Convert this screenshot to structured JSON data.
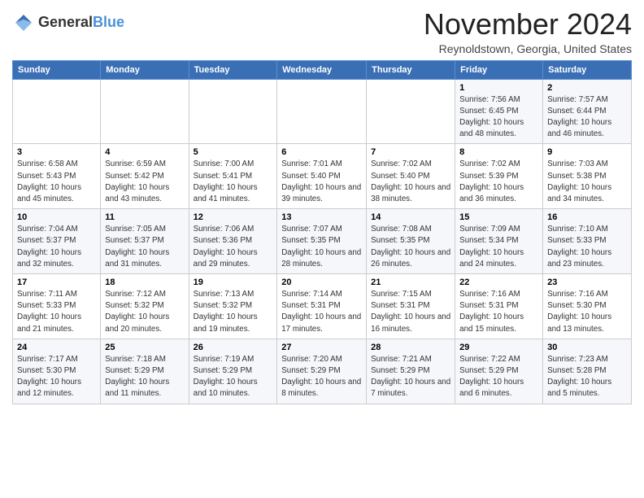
{
  "header": {
    "logo_general": "General",
    "logo_blue": "Blue",
    "month": "November 2024",
    "location": "Reynoldstown, Georgia, United States"
  },
  "weekdays": [
    "Sunday",
    "Monday",
    "Tuesday",
    "Wednesday",
    "Thursday",
    "Friday",
    "Saturday"
  ],
  "weeks": [
    [
      {
        "day": "",
        "info": ""
      },
      {
        "day": "",
        "info": ""
      },
      {
        "day": "",
        "info": ""
      },
      {
        "day": "",
        "info": ""
      },
      {
        "day": "",
        "info": ""
      },
      {
        "day": "1",
        "info": "Sunrise: 7:56 AM\nSunset: 6:45 PM\nDaylight: 10 hours and 48 minutes."
      },
      {
        "day": "2",
        "info": "Sunrise: 7:57 AM\nSunset: 6:44 PM\nDaylight: 10 hours and 46 minutes."
      }
    ],
    [
      {
        "day": "3",
        "info": "Sunrise: 6:58 AM\nSunset: 5:43 PM\nDaylight: 10 hours and 45 minutes."
      },
      {
        "day": "4",
        "info": "Sunrise: 6:59 AM\nSunset: 5:42 PM\nDaylight: 10 hours and 43 minutes."
      },
      {
        "day": "5",
        "info": "Sunrise: 7:00 AM\nSunset: 5:41 PM\nDaylight: 10 hours and 41 minutes."
      },
      {
        "day": "6",
        "info": "Sunrise: 7:01 AM\nSunset: 5:40 PM\nDaylight: 10 hours and 39 minutes."
      },
      {
        "day": "7",
        "info": "Sunrise: 7:02 AM\nSunset: 5:40 PM\nDaylight: 10 hours and 38 minutes."
      },
      {
        "day": "8",
        "info": "Sunrise: 7:02 AM\nSunset: 5:39 PM\nDaylight: 10 hours and 36 minutes."
      },
      {
        "day": "9",
        "info": "Sunrise: 7:03 AM\nSunset: 5:38 PM\nDaylight: 10 hours and 34 minutes."
      }
    ],
    [
      {
        "day": "10",
        "info": "Sunrise: 7:04 AM\nSunset: 5:37 PM\nDaylight: 10 hours and 32 minutes."
      },
      {
        "day": "11",
        "info": "Sunrise: 7:05 AM\nSunset: 5:37 PM\nDaylight: 10 hours and 31 minutes."
      },
      {
        "day": "12",
        "info": "Sunrise: 7:06 AM\nSunset: 5:36 PM\nDaylight: 10 hours and 29 minutes."
      },
      {
        "day": "13",
        "info": "Sunrise: 7:07 AM\nSunset: 5:35 PM\nDaylight: 10 hours and 28 minutes."
      },
      {
        "day": "14",
        "info": "Sunrise: 7:08 AM\nSunset: 5:35 PM\nDaylight: 10 hours and 26 minutes."
      },
      {
        "day": "15",
        "info": "Sunrise: 7:09 AM\nSunset: 5:34 PM\nDaylight: 10 hours and 24 minutes."
      },
      {
        "day": "16",
        "info": "Sunrise: 7:10 AM\nSunset: 5:33 PM\nDaylight: 10 hours and 23 minutes."
      }
    ],
    [
      {
        "day": "17",
        "info": "Sunrise: 7:11 AM\nSunset: 5:33 PM\nDaylight: 10 hours and 21 minutes."
      },
      {
        "day": "18",
        "info": "Sunrise: 7:12 AM\nSunset: 5:32 PM\nDaylight: 10 hours and 20 minutes."
      },
      {
        "day": "19",
        "info": "Sunrise: 7:13 AM\nSunset: 5:32 PM\nDaylight: 10 hours and 19 minutes."
      },
      {
        "day": "20",
        "info": "Sunrise: 7:14 AM\nSunset: 5:31 PM\nDaylight: 10 hours and 17 minutes."
      },
      {
        "day": "21",
        "info": "Sunrise: 7:15 AM\nSunset: 5:31 PM\nDaylight: 10 hours and 16 minutes."
      },
      {
        "day": "22",
        "info": "Sunrise: 7:16 AM\nSunset: 5:31 PM\nDaylight: 10 hours and 15 minutes."
      },
      {
        "day": "23",
        "info": "Sunrise: 7:16 AM\nSunset: 5:30 PM\nDaylight: 10 hours and 13 minutes."
      }
    ],
    [
      {
        "day": "24",
        "info": "Sunrise: 7:17 AM\nSunset: 5:30 PM\nDaylight: 10 hours and 12 minutes."
      },
      {
        "day": "25",
        "info": "Sunrise: 7:18 AM\nSunset: 5:29 PM\nDaylight: 10 hours and 11 minutes."
      },
      {
        "day": "26",
        "info": "Sunrise: 7:19 AM\nSunset: 5:29 PM\nDaylight: 10 hours and 10 minutes."
      },
      {
        "day": "27",
        "info": "Sunrise: 7:20 AM\nSunset: 5:29 PM\nDaylight: 10 hours and 8 minutes."
      },
      {
        "day": "28",
        "info": "Sunrise: 7:21 AM\nSunset: 5:29 PM\nDaylight: 10 hours and 7 minutes."
      },
      {
        "day": "29",
        "info": "Sunrise: 7:22 AM\nSunset: 5:29 PM\nDaylight: 10 hours and 6 minutes."
      },
      {
        "day": "30",
        "info": "Sunrise: 7:23 AM\nSunset: 5:28 PM\nDaylight: 10 hours and 5 minutes."
      }
    ]
  ]
}
